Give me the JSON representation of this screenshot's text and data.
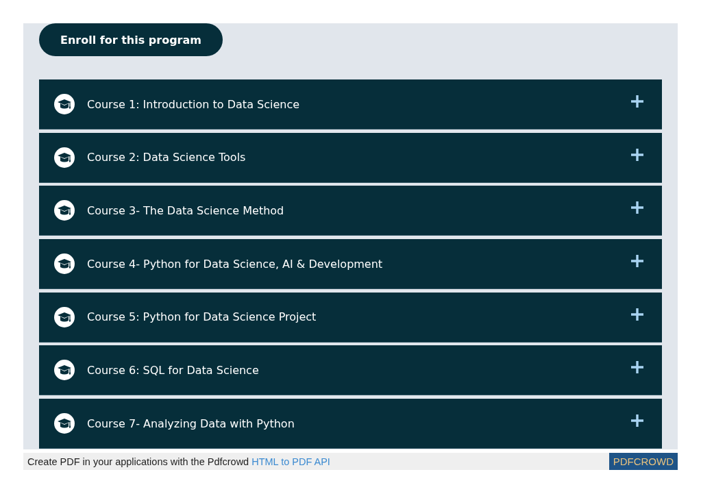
{
  "enroll_button": {
    "label": "Enroll for this program"
  },
  "courses": [
    {
      "title": "Course 1: Introduction to Data Science",
      "expanded": false
    },
    {
      "title": "Course 2: Data Science Tools",
      "expanded": false
    },
    {
      "title": "Course 3- The Data Science Method",
      "expanded": false
    },
    {
      "title": "Course 4- Python for Data Science, AI & Development",
      "expanded": false
    },
    {
      "title": "Course 5: Python for Data Science Project",
      "expanded": false
    },
    {
      "title": "Course 6: SQL for Data Science",
      "expanded": false
    },
    {
      "title": "Course 7- Analyzing Data with Python",
      "expanded": false
    }
  ],
  "footer": {
    "text": "Create PDF in your applications with the Pdfcrowd",
    "link": "HTML to PDF API",
    "badge": "PDFCROWD"
  }
}
